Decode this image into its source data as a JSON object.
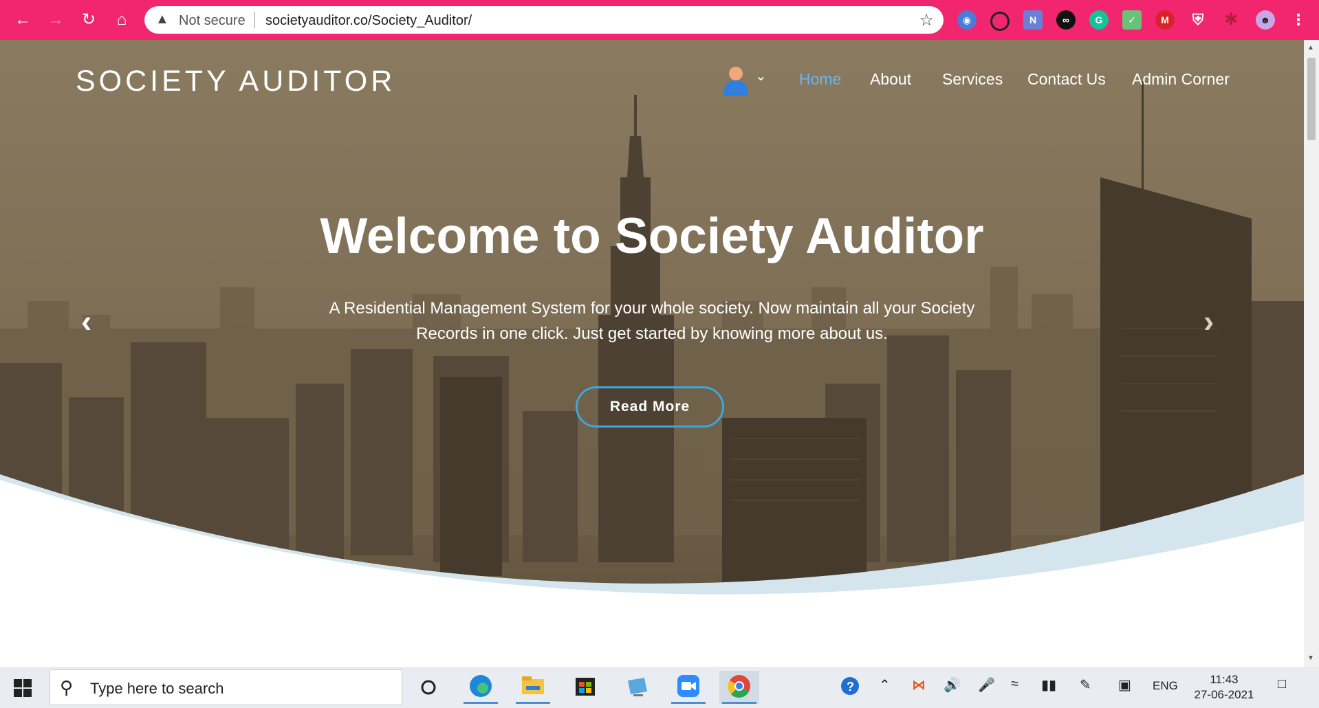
{
  "browser": {
    "security_label": "Not secure",
    "url": "societyauditor.co/Society_Auditor/"
  },
  "site": {
    "brand": "SOCIETY AUDITOR",
    "nav": [
      {
        "label": "Home",
        "active": true
      },
      {
        "label": "About",
        "active": false
      },
      {
        "label": "Services",
        "active": false
      },
      {
        "label": "Contact Us",
        "active": false
      },
      {
        "label": "Admin Corner",
        "active": false
      }
    ]
  },
  "hero": {
    "title": "Welcome to Society Auditor",
    "subtitle": "A Residential Management System for your whole society. Now maintain all your Society Records in one click. Just get started by knowing more about us.",
    "button_label": "Read More"
  },
  "taskbar": {
    "search_placeholder": "Type here to search",
    "language": "ENG",
    "time": "11:43",
    "date": "27-06-2021"
  },
  "colors": {
    "chrome_accent": "#f2266e",
    "nav_active": "#6ab4ee",
    "button_border": "#3fa6d8",
    "hero_tint": "#7a6a52",
    "wave": "#d5e5ee"
  }
}
